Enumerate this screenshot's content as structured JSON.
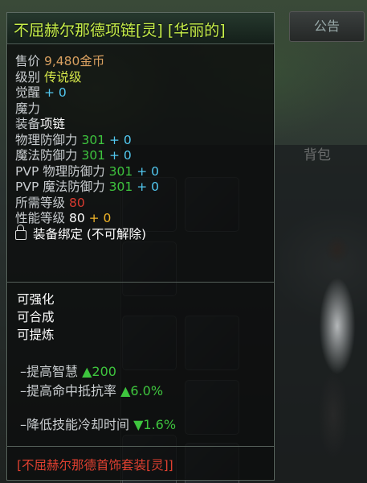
{
  "background": {
    "notice_label": "公告",
    "bag_label": "背包"
  },
  "tooltip": {
    "title": "不屈赫尔那德项链[灵] [华丽的]",
    "price_label": "售价",
    "price_value": "9,480",
    "price_unit": "金币",
    "grade_label": "级别",
    "grade_value": "传说级",
    "awaken_label": "觉醒",
    "awaken_value": "+ 0",
    "magic_label": "魔力",
    "equip_label": "装备",
    "equip_value": "项链",
    "phys_def_label": "物理防御力",
    "phys_def_value": "301",
    "phys_def_bonus": "+ 0",
    "mag_def_label": "魔法防御力",
    "mag_def_value": "301",
    "mag_def_bonus": "+ 0",
    "pvp_phys_label": "PVP 物理防御力",
    "pvp_phys_value": "301",
    "pvp_phys_bonus": "+ 0",
    "pvp_mag_label": "PVP 魔法防御力",
    "pvp_mag_value": "301",
    "pvp_mag_bonus": "+ 0",
    "req_level_label": "所需等级",
    "req_level_value": "80",
    "perf_level_label": "性能等级",
    "perf_level_value": "80",
    "perf_level_bonus": "+ 0",
    "bind_text": "装备绑定 (不可解除)",
    "props": [
      "可强化",
      "可合成",
      "可提炼"
    ],
    "bonuses": [
      {
        "label": "–提高智慧",
        "value": "▲200"
      },
      {
        "label": "–提高命中抵抗率",
        "value": "▲6.0%"
      },
      {
        "label": "–降低技能冷却时间",
        "value": "▼1.6%"
      }
    ],
    "set_name": "[不屈赫尔那德首饰套装[灵]]"
  },
  "colors": {
    "title": "#c8f04a",
    "legendary": "#d6e84a",
    "bonus_green": "#3ec53e",
    "value_cyan": "#52c8f0",
    "required_red": "#d83a30",
    "set_red": "#e04030"
  }
}
